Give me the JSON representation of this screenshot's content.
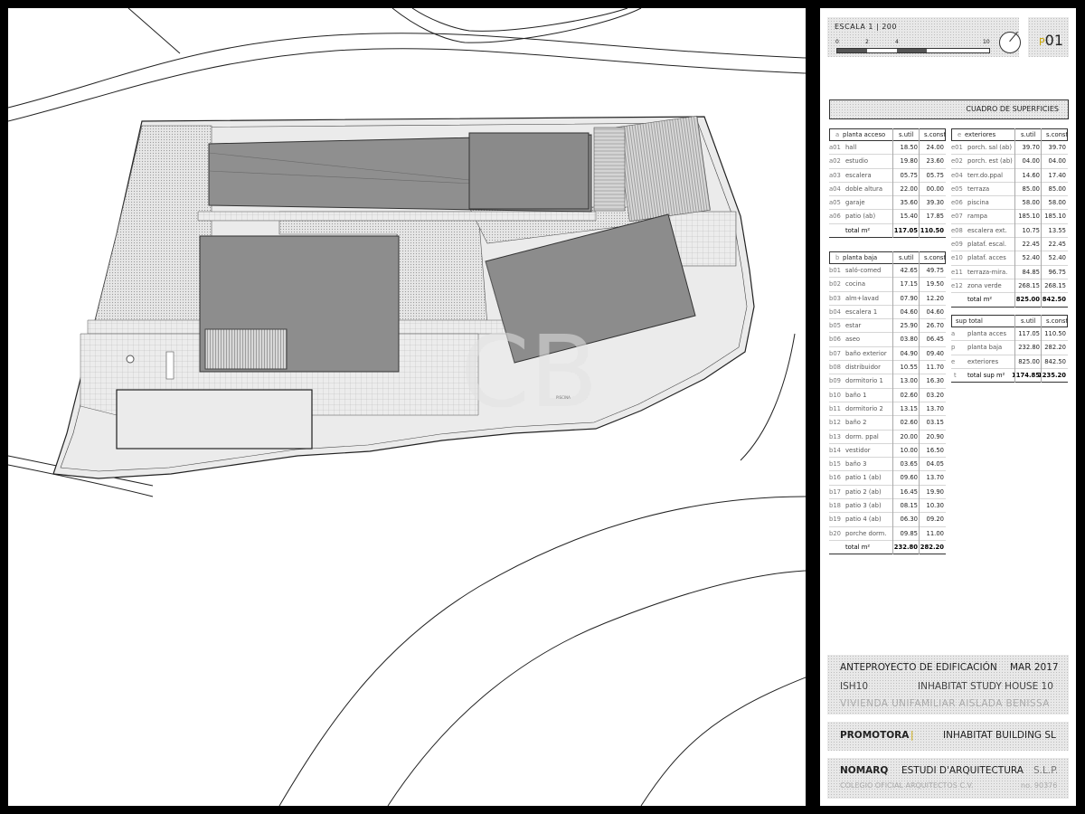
{
  "plan": {
    "watermark": "CB",
    "room_label": "PISCINA"
  },
  "sheet": {
    "scale_label": "ESCALA  1 | 200",
    "scale_ticks": [
      "0",
      "2",
      "4",
      "10"
    ],
    "sheet_prefix": "P",
    "sheet_number": "01",
    "section_title": "CUADRO DE SUPERFICIES",
    "col_util": "s.util",
    "col_const": "s.const",
    "planta_acceso": {
      "letter": "a",
      "title": "planta acceso",
      "rows": [
        {
          "code": "a01",
          "name": "hall",
          "util": "18.50",
          "const": "24.00"
        },
        {
          "code": "a02",
          "name": "estudio",
          "util": "19.80",
          "const": "23.60"
        },
        {
          "code": "a03",
          "name": "escalera",
          "util": "05.75",
          "const": "05.75"
        },
        {
          "code": "a04",
          "name": "doble altura",
          "util": "22.00",
          "const": "00.00"
        },
        {
          "code": "a05",
          "name": "garaje",
          "util": "35.60",
          "const": "39.30"
        },
        {
          "code": "a06",
          "name": "patio (ab)",
          "util": "15.40",
          "const": "17.85"
        }
      ],
      "total_label": "total m²",
      "total_util": "117.05",
      "total_const": "110.50"
    },
    "planta_baja": {
      "letter": "b",
      "title": "planta baja",
      "rows": [
        {
          "code": "b01",
          "name": "saló-comed",
          "util": "42.65",
          "const": "49.75"
        },
        {
          "code": "b02",
          "name": "cocina",
          "util": "17.15",
          "const": "19.50"
        },
        {
          "code": "b03",
          "name": "alm+lavad",
          "util": "07.90",
          "const": "12.20"
        },
        {
          "code": "b04",
          "name": "escalera 1",
          "util": "04.60",
          "const": "04.60"
        },
        {
          "code": "b05",
          "name": "estar",
          "util": "25.90",
          "const": "26.70"
        },
        {
          "code": "b06",
          "name": "aseo",
          "util": "03.80",
          "const": "06.45"
        },
        {
          "code": "b07",
          "name": "baño exterior",
          "util": "04.90",
          "const": "09.40"
        },
        {
          "code": "b08",
          "name": "distribuidor",
          "util": "10.55",
          "const": "11.70"
        },
        {
          "code": "b09",
          "name": "dormitorio 1",
          "util": "13.00",
          "const": "16.30"
        },
        {
          "code": "b10",
          "name": "baño 1",
          "util": "02.60",
          "const": "03.20"
        },
        {
          "code": "b11",
          "name": "dormitorio 2",
          "util": "13.15",
          "const": "13.70"
        },
        {
          "code": "b12",
          "name": "baño 2",
          "util": "02.60",
          "const": "03.15"
        },
        {
          "code": "b13",
          "name": "dorm. ppal",
          "util": "20.00",
          "const": "20.90"
        },
        {
          "code": "b14",
          "name": "vestidor",
          "util": "10.00",
          "const": "16.50"
        },
        {
          "code": "b15",
          "name": "baño 3",
          "util": "03.65",
          "const": "04.05"
        },
        {
          "code": "b16",
          "name": "patio 1 (ab)",
          "util": "09.60",
          "const": "13.70"
        },
        {
          "code": "b17",
          "name": "patio 2 (ab)",
          "util": "16.45",
          "const": "19.90"
        },
        {
          "code": "b18",
          "name": "patio 3 (ab)",
          "util": "08.15",
          "const": "10.30"
        },
        {
          "code": "b19",
          "name": "patio 4 (ab)",
          "util": "06.30",
          "const": "09.20"
        },
        {
          "code": "b20",
          "name": "porche dorm.",
          "util": "09.85",
          "const": "11.00"
        }
      ],
      "total_label": "total m²",
      "total_util": "232.80",
      "total_const": "282.20"
    },
    "exteriores": {
      "letter": "e",
      "title": "exteriores",
      "rows": [
        {
          "code": "e01",
          "name": "porch. sal (ab)",
          "util": "39.70",
          "const": "39.70"
        },
        {
          "code": "e02",
          "name": "porch. est (ab)",
          "util": "04.00",
          "const": "04.00"
        },
        {
          "code": "e04",
          "name": "terr.do.ppal",
          "util": "14.60",
          "const": "17.40"
        },
        {
          "code": "e05",
          "name": "terraza",
          "util": "85.00",
          "const": "85.00"
        },
        {
          "code": "e06",
          "name": "piscina",
          "util": "58.00",
          "const": "58.00"
        },
        {
          "code": "e07",
          "name": "rampa",
          "util": "185.10",
          "const": "185.10"
        },
        {
          "code": "e08",
          "name": "escalera ext.",
          "util": "10.75",
          "const": "13.55"
        },
        {
          "code": "e09",
          "name": "plataf. escal.",
          "util": "22.45",
          "const": "22.45"
        },
        {
          "code": "e10",
          "name": "plataf. acces",
          "util": "52.40",
          "const": "52.40"
        },
        {
          "code": "e11",
          "name": "terraza-mira.",
          "util": "84.85",
          "const": "96.75"
        },
        {
          "code": "e12",
          "name": "zona verde",
          "util": "268.15",
          "const": "268.15"
        }
      ],
      "total_label": "total m²",
      "total_util": "825.00",
      "total_const": "842.50"
    },
    "sup_total": {
      "title": "sup total",
      "rows": [
        {
          "code": "a",
          "name": "planta acces",
          "util": "117.05",
          "const": "110.50"
        },
        {
          "code": "p",
          "name": "planta baja",
          "util": "232.80",
          "const": "282.20"
        },
        {
          "code": "e",
          "name": "exteriores",
          "util": "825.00",
          "const": "842.50"
        }
      ],
      "total_code": "t",
      "total_label": "total sup m²",
      "total_util": "1174.85",
      "total_const": "1235.20"
    },
    "project": {
      "phase": "ANTEPROYECTO DE EDIFICACIÓN",
      "date": "MAR 2017",
      "code": "ISH10",
      "name": "INHABITAT STUDY HOUSE 10",
      "description": "VIVIENDA UNIFAMILIAR AISLADA BENISSA"
    },
    "promotora": {
      "label": "PROMOTORA",
      "separator": "|",
      "value": "INHABITAT BUILDING SL"
    },
    "architect": {
      "name": "NOMARQ",
      "studio": "ESTUDI D'ARQUITECTURA",
      "suffix": "S.L.P.",
      "college": "COLEGIO OFICIAL ARQUITECTOS C.V.",
      "number": "no. 90376"
    }
  }
}
